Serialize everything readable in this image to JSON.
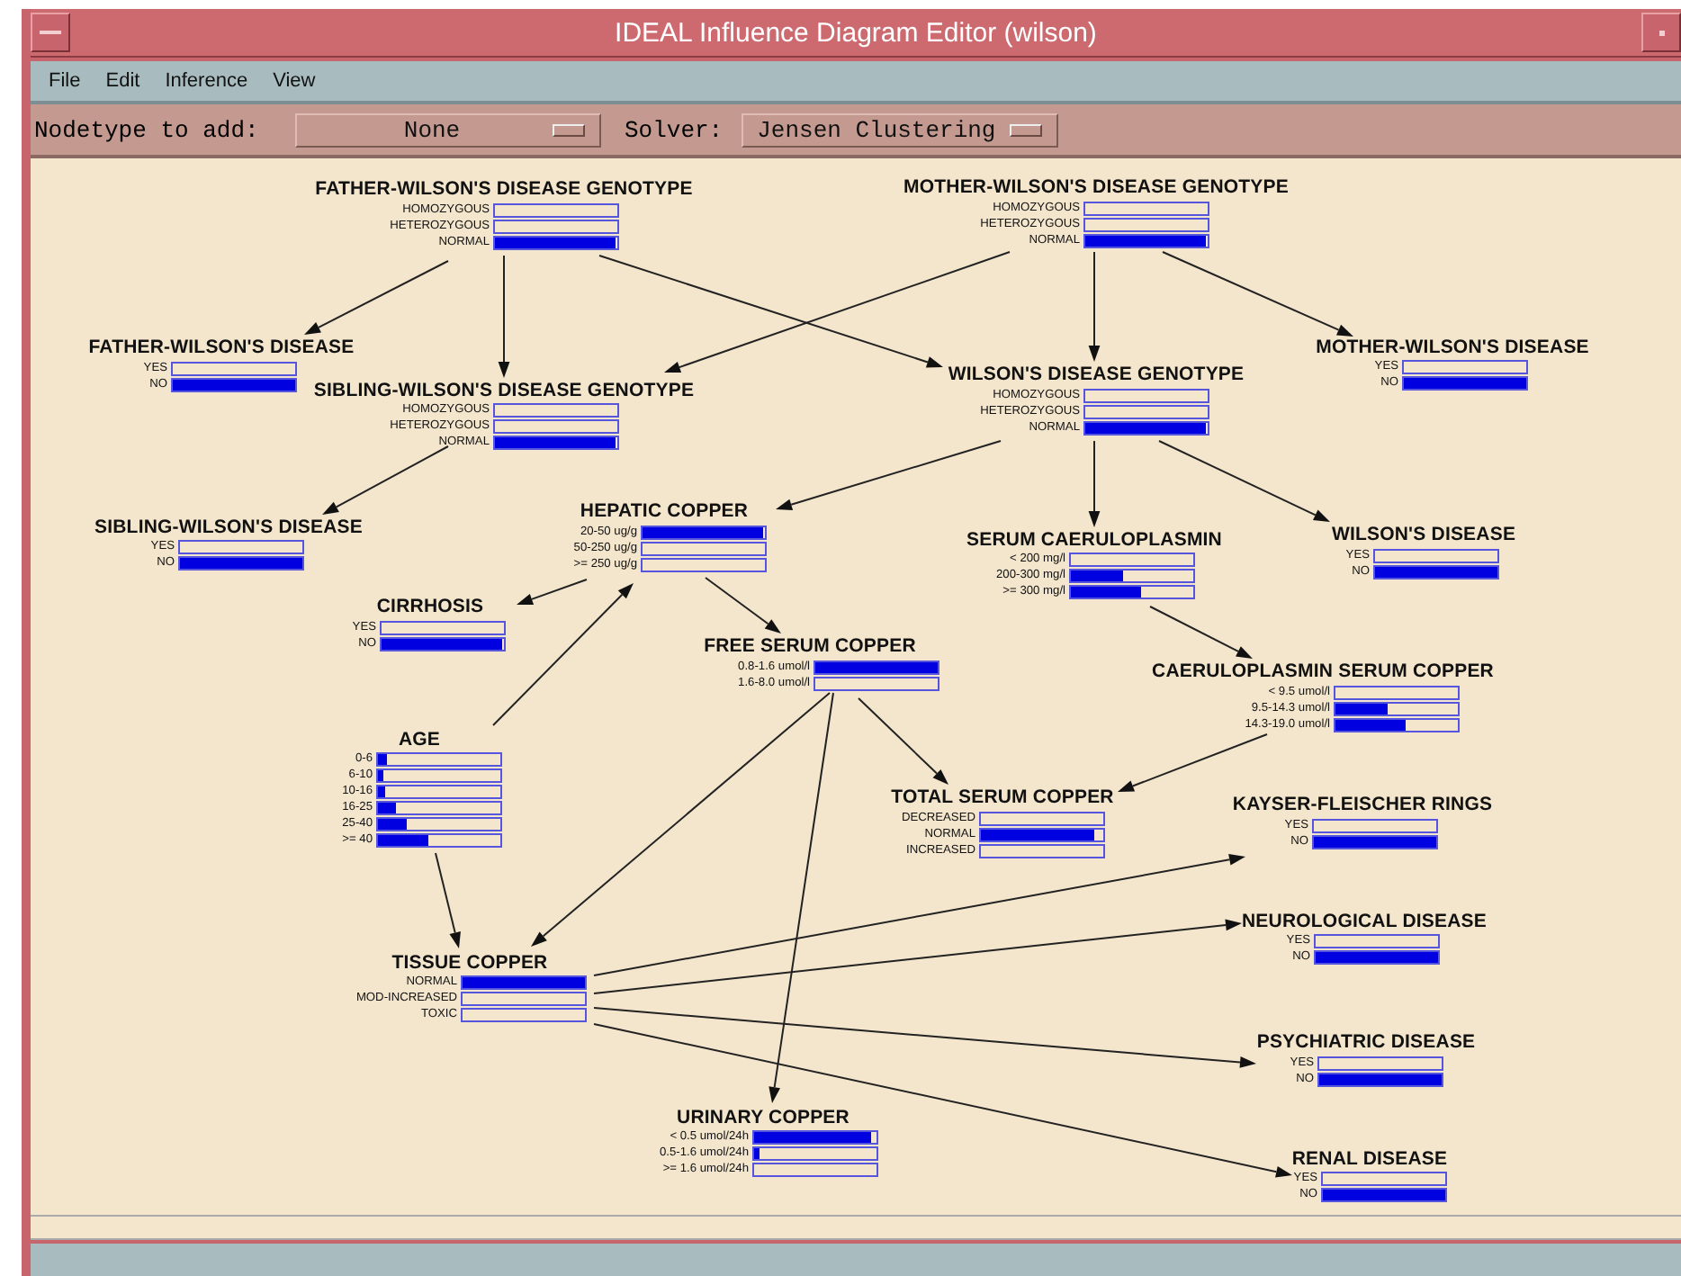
{
  "window": {
    "title": "IDEAL Influence Diagram Editor (wilson)"
  },
  "menu": [
    "File",
    "Edit",
    "Inference",
    "View"
  ],
  "toolbar": {
    "nodetype_label": "Nodetype to add:",
    "nodetype_value": "None",
    "solver_label": "Solver:",
    "solver_value": "Jensen Clustering"
  },
  "nodes": [
    {
      "title": "FATHER-WILSON'S DISEASE GENOTYPE",
      "states": [
        {
          "label": "HOMOZYGOUS",
          "level": 0
        },
        {
          "label": "HETEROZYGOUS",
          "level": 0
        },
        {
          "label": "NORMAL",
          "level": 0.98
        }
      ]
    },
    {
      "title": "MOTHER-WILSON'S DISEASE GENOTYPE",
      "states": [
        {
          "label": "HOMOZYGOUS",
          "level": 0
        },
        {
          "label": "HETEROZYGOUS",
          "level": 0
        },
        {
          "label": "NORMAL",
          "level": 0.98
        }
      ]
    },
    {
      "title": "FATHER-WILSON'S DISEASE",
      "states": [
        {
          "label": "YES",
          "level": 0
        },
        {
          "label": "NO",
          "level": 1
        }
      ]
    },
    {
      "title": "SIBLING-WILSON'S DISEASE GENOTYPE",
      "states": [
        {
          "label": "HOMOZYGOUS",
          "level": 0
        },
        {
          "label": "HETEROZYGOUS",
          "level": 0
        },
        {
          "label": "NORMAL",
          "level": 0.98
        }
      ]
    },
    {
      "title": "WILSON'S DISEASE GENOTYPE",
      "states": [
        {
          "label": "HOMOZYGOUS",
          "level": 0
        },
        {
          "label": "HETEROZYGOUS",
          "level": 0
        },
        {
          "label": "NORMAL",
          "level": 0.98
        }
      ]
    },
    {
      "title": "MOTHER-WILSON'S DISEASE",
      "states": [
        {
          "label": "YES",
          "level": 0
        },
        {
          "label": "NO",
          "level": 1
        }
      ]
    },
    {
      "title": "SIBLING-WILSON'S DISEASE",
      "states": [
        {
          "label": "YES",
          "level": 0
        },
        {
          "label": "NO",
          "level": 1
        }
      ]
    },
    {
      "title": "HEPATIC COPPER",
      "states": [
        {
          "label": "20-50 ug/g",
          "level": 0.98
        },
        {
          "label": "50-250 ug/g",
          "level": 0
        },
        {
          "label": ">= 250 ug/g",
          "level": 0
        }
      ]
    },
    {
      "title": "SERUM CAERULOPLASMIN",
      "states": [
        {
          "label": "< 200 mg/l",
          "level": 0
        },
        {
          "label": "200-300 mg/l",
          "level": 0.42
        },
        {
          "label": ">= 300 mg/l",
          "level": 0.57
        }
      ]
    },
    {
      "title": "WILSON'S DISEASE",
      "states": [
        {
          "label": "YES",
          "level": 0
        },
        {
          "label": "NO",
          "level": 1
        }
      ]
    },
    {
      "title": "CIRRHOSIS",
      "states": [
        {
          "label": "YES",
          "level": 0
        },
        {
          "label": "NO",
          "level": 0.98
        }
      ]
    },
    {
      "title": "FREE SERUM COPPER",
      "states": [
        {
          "label": "0.8-1.6 umol/l",
          "level": 1
        },
        {
          "label": "1.6-8.0 umol/l",
          "level": 0
        }
      ]
    },
    {
      "title": "CAERULOPLASMIN SERUM COPPER",
      "states": [
        {
          "label": "< 9.5 umol/l",
          "level": 0
        },
        {
          "label": "9.5-14.3 umol/l",
          "level": 0.42
        },
        {
          "label": "14.3-19.0 umol/l",
          "level": 0.57
        }
      ]
    },
    {
      "title": "AGE",
      "states": [
        {
          "label": "0-6",
          "level": 0.07
        },
        {
          "label": "6-10",
          "level": 0.04
        },
        {
          "label": "10-16",
          "level": 0.06
        },
        {
          "label": "16-25",
          "level": 0.14
        },
        {
          "label": "25-40",
          "level": 0.23
        },
        {
          "label": ">= 40",
          "level": 0.41
        }
      ]
    },
    {
      "title": "TOTAL SERUM COPPER",
      "states": [
        {
          "label": "DECREASED",
          "level": 0
        },
        {
          "label": "NORMAL",
          "level": 0.93
        },
        {
          "label": "INCREASED",
          "level": 0
        }
      ]
    },
    {
      "title": "KAYSER-FLEISCHER RINGS",
      "states": [
        {
          "label": "YES",
          "level": 0
        },
        {
          "label": "NO",
          "level": 1
        }
      ]
    },
    {
      "title": "NEUROLOGICAL DISEASE",
      "states": [
        {
          "label": "YES",
          "level": 0
        },
        {
          "label": "NO",
          "level": 1
        }
      ]
    },
    {
      "title": "TISSUE COPPER",
      "states": [
        {
          "label": "NORMAL",
          "level": 1
        },
        {
          "label": "MOD-INCREASED",
          "level": 0
        },
        {
          "label": "TOXIC",
          "level": 0
        }
      ]
    },
    {
      "title": "PSYCHIATRIC DISEASE",
      "states": [
        {
          "label": "YES",
          "level": 0
        },
        {
          "label": "NO",
          "level": 1
        }
      ]
    },
    {
      "title": "URINARY COPPER",
      "states": [
        {
          "label": "< 0.5 umol/24h",
          "level": 0.95
        },
        {
          "label": "0.5-1.6 umol/24h",
          "level": 0.04
        },
        {
          "label": ">= 1.6 umol/24h",
          "level": 0
        }
      ]
    },
    {
      "title": "RENAL DISEASE",
      "states": [
        {
          "label": "YES",
          "level": 0
        },
        {
          "label": "NO",
          "level": 1
        }
      ]
    }
  ]
}
